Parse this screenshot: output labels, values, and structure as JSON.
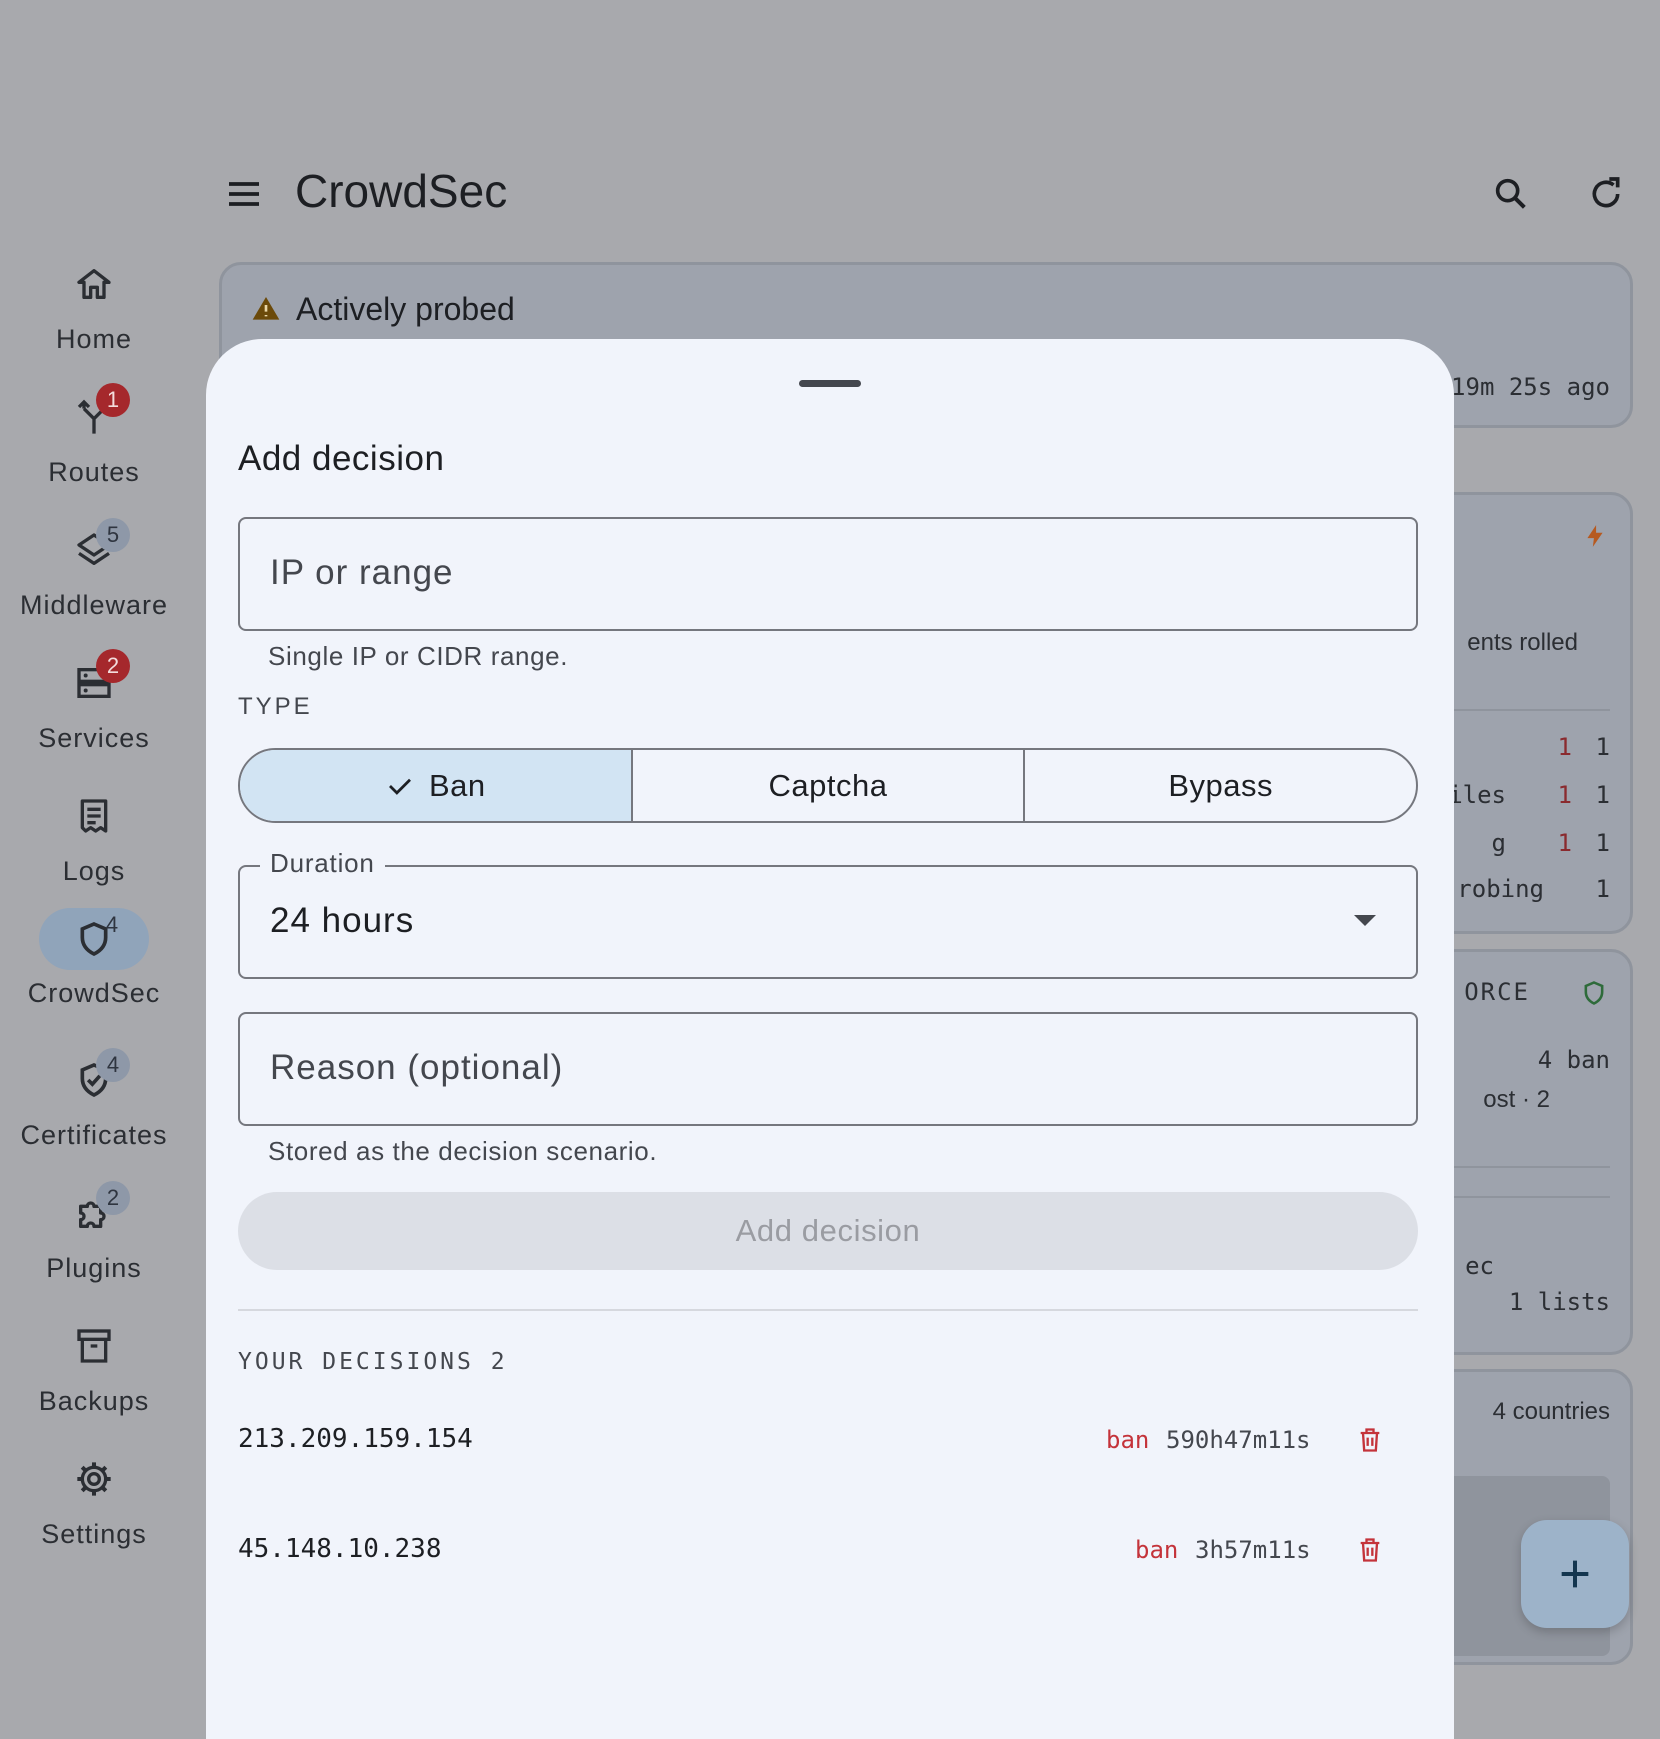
{
  "app": {
    "title": "CrowdSec",
    "menu_icon": "menu-icon",
    "search_icon": "search-icon",
    "refresh_icon": "refresh-icon"
  },
  "rail": {
    "items": [
      {
        "label": "Home",
        "icon": "home-icon",
        "badge": ""
      },
      {
        "label": "Routes",
        "icon": "routes-icon",
        "badge": "1"
      },
      {
        "label": "Middleware",
        "icon": "layers-icon",
        "badge": "5"
      },
      {
        "label": "Services",
        "icon": "server-icon",
        "badge": "2"
      },
      {
        "label": "Logs",
        "icon": "receipt-icon",
        "badge": ""
      },
      {
        "label": "CrowdSec",
        "icon": "shield-icon",
        "badge": "4"
      },
      {
        "label": "Certificates",
        "icon": "verified-shield-icon",
        "badge": "4"
      },
      {
        "label": "Plugins",
        "icon": "puzzle-icon",
        "badge": "2"
      },
      {
        "label": "Backups",
        "icon": "archive-icon",
        "badge": ""
      },
      {
        "label": "Settings",
        "icon": "gear-icon",
        "badge": ""
      }
    ]
  },
  "background": {
    "alert_title": "Actively probed",
    "alert_time": "19m 25s ago",
    "events_text": "ents rolled",
    "rows": [
      {
        "name": "",
        "count_lock": "1",
        "count": "1"
      },
      {
        "name": "files",
        "count_lock": "1",
        "count": "1"
      },
      {
        "name": "g",
        "count_lock": "1",
        "count": "1"
      },
      {
        "name": "robing",
        "count_lock": "",
        "count": "1"
      }
    ],
    "enforce_label": "ORCE",
    "ban_summary": "4 ban",
    "host_summary": "ost · 2",
    "ec_text": "ec",
    "lists_text": "1 lists",
    "countries_text": "4 countries"
  },
  "sheet": {
    "title": "Add decision",
    "ip_placeholder": "IP or range",
    "ip_helper": "Single IP or CIDR range.",
    "type_label": "TYPE",
    "types": [
      {
        "label": "Ban",
        "selected": true
      },
      {
        "label": "Captcha",
        "selected": false
      },
      {
        "label": "Bypass",
        "selected": false
      }
    ],
    "duration_label": "Duration",
    "duration_value": "24 hours",
    "reason_placeholder": "Reason (optional)",
    "reason_helper": "Stored as the decision scenario.",
    "submit_label": "Add decision",
    "decisions_header": "YOUR DECISIONS 2",
    "decisions": [
      {
        "ip": "213.209.159.154",
        "type": "ban",
        "remaining": "590h47m11s"
      },
      {
        "ip": "45.148.10.238",
        "type": "ban",
        "remaining": "3h57m11s"
      }
    ]
  },
  "colors": {
    "accent_selected": "#d2e4f3",
    "ban_red": "#c4333a",
    "badge_red": "#a5282c",
    "sheet_bg": "#f1f4fb"
  }
}
